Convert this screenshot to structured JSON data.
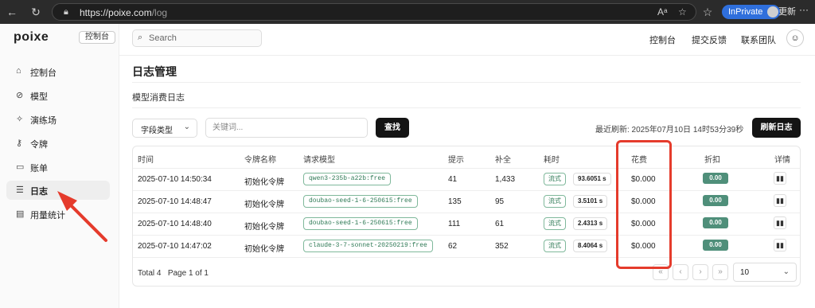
{
  "browser": {
    "url_host": "https://poixe.com",
    "url_path": "/log",
    "inprivate_label": "InPrivate",
    "update_label": "更新"
  },
  "sidebar": {
    "logo": "poixe",
    "badge": "控制台",
    "items": [
      {
        "label": "控制台",
        "icon": "home-icon"
      },
      {
        "label": "模型",
        "icon": "model-icon"
      },
      {
        "label": "演练场",
        "icon": "sparkle-icon"
      },
      {
        "label": "令牌",
        "icon": "key-icon"
      },
      {
        "label": "账单",
        "icon": "card-icon"
      },
      {
        "label": "日志",
        "icon": "list-icon",
        "active": true
      },
      {
        "label": "用量统计",
        "icon": "chart-icon"
      }
    ]
  },
  "topbar": {
    "search_placeholder": "Search",
    "links": [
      "控制台",
      "提交反馈",
      "联系团队"
    ]
  },
  "page": {
    "title": "日志管理",
    "subtitle": "模型消费日志",
    "field_select": "字段类型",
    "keyword_placeholder": "关键词...",
    "search_button": "查找",
    "last_refresh": "最近刷新: 2025年07月10日 14时53分39秒",
    "refresh_button": "刷新日志"
  },
  "table": {
    "headers": [
      "时间",
      "令牌名称",
      "请求模型",
      "提示",
      "补全",
      "耗时",
      "花费",
      "折扣",
      "详情"
    ],
    "rows": [
      {
        "time": "2025-07-10 14:50:34",
        "token": "初始化令牌",
        "model": "qwen3-235b-a22b:free",
        "prompt": "41",
        "completion": "1,433",
        "mode": "流式",
        "duration": "93.6051 s",
        "cost": "$0.000",
        "discount": "0.00"
      },
      {
        "time": "2025-07-10 14:48:47",
        "token": "初始化令牌",
        "model": "doubao-seed-1-6-250615:free",
        "prompt": "135",
        "completion": "95",
        "mode": "流式",
        "duration": "3.5101 s",
        "cost": "$0.000",
        "discount": "0.00"
      },
      {
        "time": "2025-07-10 14:48:40",
        "token": "初始化令牌",
        "model": "doubao-seed-1-6-250615:free",
        "prompt": "111",
        "completion": "61",
        "mode": "流式",
        "duration": "2.4313 s",
        "cost": "$0.000",
        "discount": "0.00"
      },
      {
        "time": "2025-07-10 14:47:02",
        "token": "初始化令牌",
        "model": "claude-3-7-sonnet-20250219:free",
        "prompt": "62",
        "completion": "352",
        "mode": "流式",
        "duration": "8.4064 s",
        "cost": "$0.000",
        "discount": "0.00"
      }
    ],
    "total": "Total 4",
    "page_info": "Page 1 of 1",
    "page_size": "10"
  },
  "colors": {
    "highlight": "#e53b2c",
    "discount_bg": "#4f8f7a",
    "tag_green": "#2f7a56"
  }
}
